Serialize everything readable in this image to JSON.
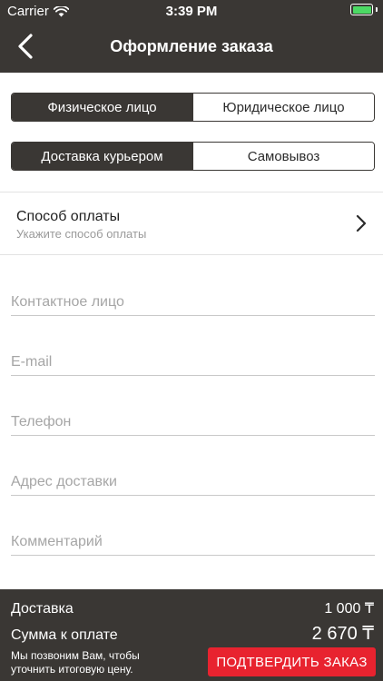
{
  "status_bar": {
    "carrier": "Carrier",
    "time": "3:39 PM",
    "battery_color": "#4cd964"
  },
  "header": {
    "title": "Оформление заказа",
    "back_icon": "chevron-left-icon"
  },
  "customer_type": {
    "options": [
      "Физическое лицо",
      "Юридическое лицо"
    ],
    "selected": 0
  },
  "delivery_method": {
    "options": [
      "Доставка курьером",
      "Самовывоз"
    ],
    "selected": 0
  },
  "payment": {
    "label": "Способ оплаты",
    "hint": "Укажите способ оплаты"
  },
  "form": {
    "contact_placeholder": "Контактное лицо",
    "email_placeholder": "E-mail",
    "phone_placeholder": "Телефон",
    "address_placeholder": "Адрес доставки",
    "comment_placeholder": "Комментарий"
  },
  "footer": {
    "delivery_label": "Доставка",
    "delivery_value": "1 000 ₸",
    "total_label": "Сумма к оплате",
    "total_value": "2 670 ₸",
    "note": "Мы позвоним Вам, чтобы уточнить итоговую цену.",
    "confirm_label": "ПОДТВЕРДИТЬ ЗАКАЗ"
  },
  "colors": {
    "bar": "#3a3734",
    "accent": "#e8232f"
  }
}
